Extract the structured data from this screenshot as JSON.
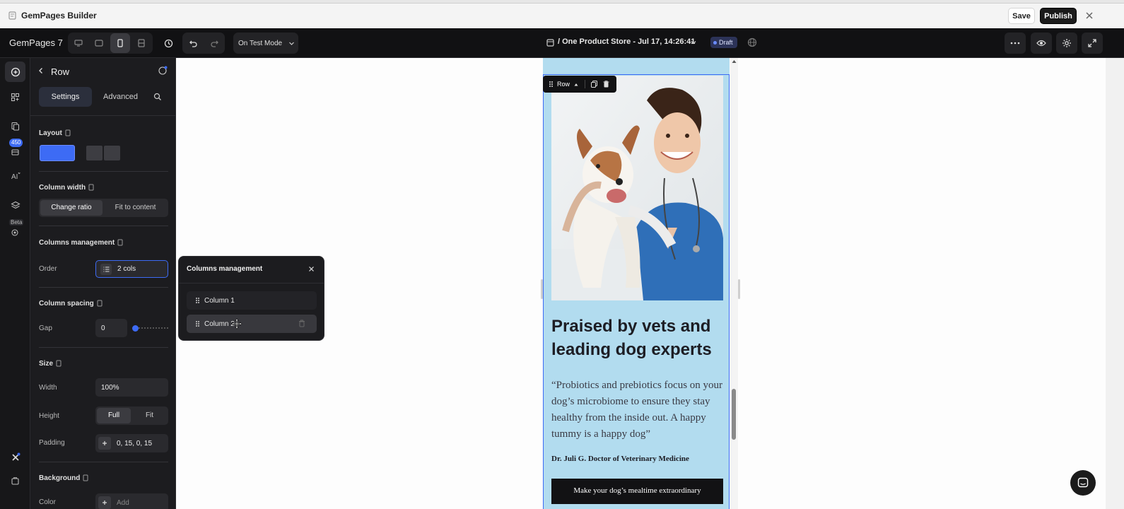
{
  "window": {
    "title": "GemPages Builder",
    "save_label": "Save",
    "publish_label": "Publish"
  },
  "toolbar": {
    "brand": "GemPages 7",
    "mode": "On Test Mode",
    "page_title": "/ One Product Store - Jul 17, 14:26:41",
    "status_badge": "Draft"
  },
  "rail": {
    "badge_count": "450",
    "beta_label": "Beta"
  },
  "panel": {
    "title": "Row",
    "tabs": [
      "Settings",
      "Advanced"
    ],
    "layout": {
      "label": "Layout"
    },
    "column_width": {
      "label": "Column width",
      "options": [
        "Change ratio",
        "Fit to content"
      ]
    },
    "columns_management": {
      "label": "Columns management",
      "order_label": "Order",
      "order_value": "2 cols"
    },
    "column_spacing": {
      "label": "Column spacing",
      "gap_label": "Gap",
      "gap_value": "0"
    },
    "size": {
      "label": "Size",
      "width_label": "Width",
      "width_value": "100%",
      "height_label": "Height",
      "height_options": [
        "Full",
        "Fit"
      ],
      "padding_label": "Padding",
      "padding_value": "0, 15, 0, 15"
    },
    "background": {
      "label": "Background",
      "color_label": "Color",
      "color_placeholder": "Add"
    }
  },
  "columns_popup": {
    "title": "Columns management",
    "items": [
      "Column 1",
      "Column 2"
    ]
  },
  "preview": {
    "row_tag": "Row",
    "heading": "Praised by vets and leading dog experts",
    "quote": "“Probiotics and prebiotics focus on your dog’s microbiome to ensure they stay healthy from the inside out. A happy tummy is a happy dog”",
    "author": "Dr. Juli G. Doctor of Veterinary Medicine",
    "cta": "Make your dog’s mealtime extraordinary"
  },
  "colors": {
    "accent": "#3d6bf5",
    "preview_bg": "#b2dcef",
    "draft": "#4a5aa8"
  }
}
